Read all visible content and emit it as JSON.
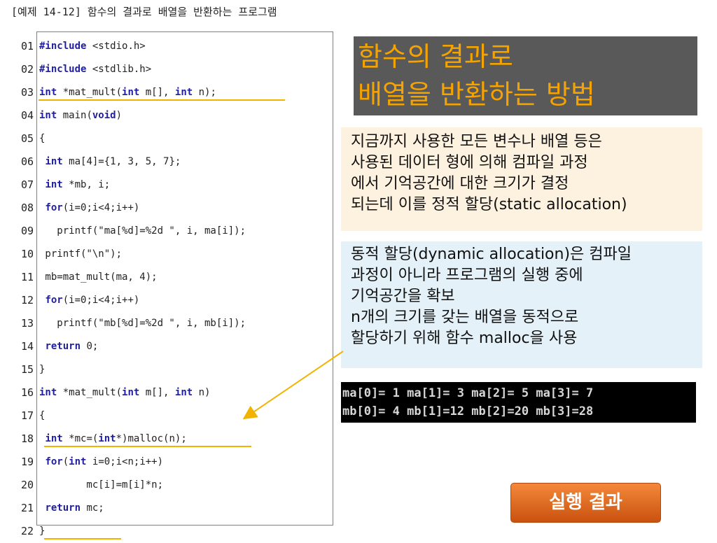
{
  "caption": "[예제 14-12] 함수의 결과로 배열을 반환하는 프로그램",
  "line_numbers": [
    "01",
    "02",
    "03",
    "04",
    "05",
    "06",
    "07",
    "08",
    "09",
    "10",
    "11",
    "12",
    "13",
    "14",
    "15",
    "16",
    "17",
    "18",
    "19",
    "20",
    "21",
    "22"
  ],
  "code_lines": [
    [
      {
        "t": "#include",
        "k": 1
      },
      {
        "t": " <stdio.h>"
      }
    ],
    [
      {
        "t": "#include",
        "k": 1
      },
      {
        "t": " <stdlib.h>"
      }
    ],
    [
      {
        "t": "int",
        "k": 1
      },
      {
        "t": " *mat_mult("
      },
      {
        "t": "int",
        "k": 1
      },
      {
        "t": " m[], "
      },
      {
        "t": "int",
        "k": 1
      },
      {
        "t": " n);"
      }
    ],
    [
      {
        "t": "int",
        "k": 1
      },
      {
        "t": " main("
      },
      {
        "t": "void",
        "k": 1
      },
      {
        "t": ")"
      }
    ],
    [
      {
        "t": "{"
      }
    ],
    [
      {
        "t": " "
      },
      {
        "t": "int",
        "k": 1
      },
      {
        "t": " ma[4]={1, 3, 5, 7};"
      }
    ],
    [
      {
        "t": " "
      },
      {
        "t": "int",
        "k": 1
      },
      {
        "t": " *mb, i;"
      }
    ],
    [
      {
        "t": " "
      },
      {
        "t": "for",
        "k": 1
      },
      {
        "t": "(i=0;i<4;i++)"
      }
    ],
    [
      {
        "t": "   printf(\"ma[%d]=%2d \", i, ma[i]);"
      }
    ],
    [
      {
        "t": " printf(\"\\n\");"
      }
    ],
    [
      {
        "t": " mb=mat_mult(ma, 4);"
      }
    ],
    [
      {
        "t": " "
      },
      {
        "t": "for",
        "k": 1
      },
      {
        "t": "(i=0;i<4;i++)"
      }
    ],
    [
      {
        "t": "   printf(\"mb[%d]=%2d \", i, mb[i]);"
      }
    ],
    [
      {
        "t": " "
      },
      {
        "t": "return",
        "k": 1
      },
      {
        "t": " 0;"
      }
    ],
    [
      {
        "t": "}"
      }
    ],
    [
      {
        "t": "int",
        "k": 1
      },
      {
        "t": " *mat_mult("
      },
      {
        "t": "int",
        "k": 1
      },
      {
        "t": " m[], "
      },
      {
        "t": "int",
        "k": 1
      },
      {
        "t": " n)"
      }
    ],
    [
      {
        "t": "{"
      }
    ],
    [
      {
        "t": " "
      },
      {
        "t": "int",
        "k": 1
      },
      {
        "t": " *mc=("
      },
      {
        "t": "int",
        "k": 1
      },
      {
        "t": "*)malloc(n);"
      }
    ],
    [
      {
        "t": " "
      },
      {
        "t": "for",
        "k": 1
      },
      {
        "t": "("
      },
      {
        "t": "int",
        "k": 1
      },
      {
        "t": " i=0;i<n;i++)"
      }
    ],
    [
      {
        "t": "        mc[i]=m[i]*n;"
      }
    ],
    [
      {
        "t": " "
      },
      {
        "t": "return",
        "k": 1
      },
      {
        "t": " mc;"
      }
    ],
    [
      {
        "t": "}"
      }
    ]
  ],
  "title": {
    "line1": "함수의 결과로",
    "line2": "배열을 반환하는 방법"
  },
  "static_box": {
    "lines": [
      "지금까지 사용한 모든 변수나 배열 등은",
      "사용된 데이터 형에 의해 컴파일 과정",
      "에서 기억공간에 대한 크기가 결정",
      "되는데 이를 정적 할당(static allocation)"
    ]
  },
  "dynamic_box": {
    "lines": [
      "동적 할당(dynamic allocation)은 컴파일",
      "과정이 아니라 프로그램의 실행 중에",
      "기억공간을 확보",
      "n개의 크기를 갖는 배열을 동적으로",
      "할당하기 위해 함수 malloc을 사용"
    ]
  },
  "console": {
    "lines": [
      "ma[0]= 1 ma[1]= 3 ma[2]= 5 ma[3]= 7",
      "mb[0]= 4 mb[1]=12 mb[2]=20 mb[3]=28"
    ]
  },
  "run_button": {
    "label": "실행 결과"
  },
  "colors": {
    "title_bg": "#595959",
    "title_text": "#f5a300",
    "highlight": "#f0b400",
    "keyword": "#1f1f9f",
    "button": "#e0641c"
  }
}
